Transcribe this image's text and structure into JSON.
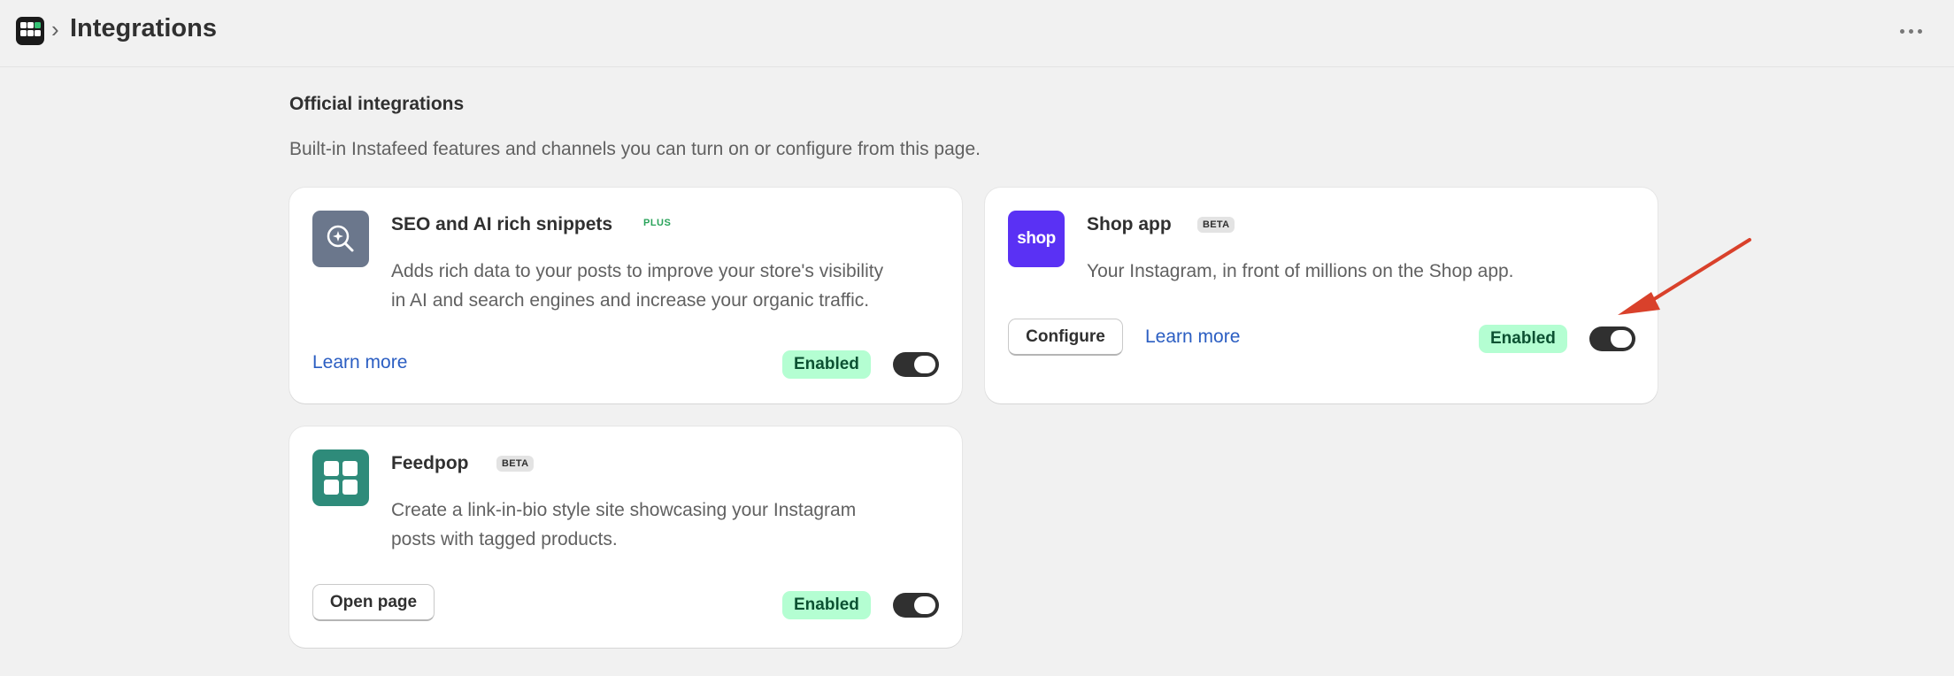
{
  "header": {
    "title": "Integrations",
    "separator": "›",
    "app_logo_icon": "app-grid-logo-icon",
    "more_icon": "ellipsis-horizontal-icon"
  },
  "section": {
    "heading": "Official integrations",
    "description": "Built-in Instafeed features and channels you can turn on or configure from this page."
  },
  "cards": [
    {
      "title": "SEO and AI rich snippets",
      "tag": "PLUS",
      "description_lines": [
        "Adds rich data to your posts to improve your store's visibility",
        "in AI and search engines and increase your organic traffic."
      ],
      "link_label": "Learn more",
      "status": "Enabled",
      "toggle_on": true,
      "icon": "search-sparkle-icon",
      "icon_color": "#6b778c"
    },
    {
      "title": "Shop app",
      "tag": "BETA",
      "description_lines": [
        "Your Instagram, in front of millions on the Shop app."
      ],
      "button_label": "Configure",
      "link_label": "Learn more",
      "status": "Enabled",
      "toggle_on": true,
      "icon": "shop-logo-icon",
      "icon_text": "shop",
      "icon_color": "#5a31f4"
    },
    {
      "title": "Feedpop",
      "tag": "BETA",
      "description_lines": [
        "Create a link-in-bio style site showcasing your Instagram",
        "posts with tagged products."
      ],
      "button_label": "Open page",
      "status": "Enabled",
      "toggle_on": true,
      "icon": "feedpop-grid-icon",
      "icon_color": "#2e8b7a"
    }
  ],
  "colors": {
    "background": "#f1f1f1",
    "link": "#2b5ec2",
    "enabled_badge": "#b4fed2",
    "toggle_on": "#303030",
    "annotation_arrow": "#d9412b"
  }
}
